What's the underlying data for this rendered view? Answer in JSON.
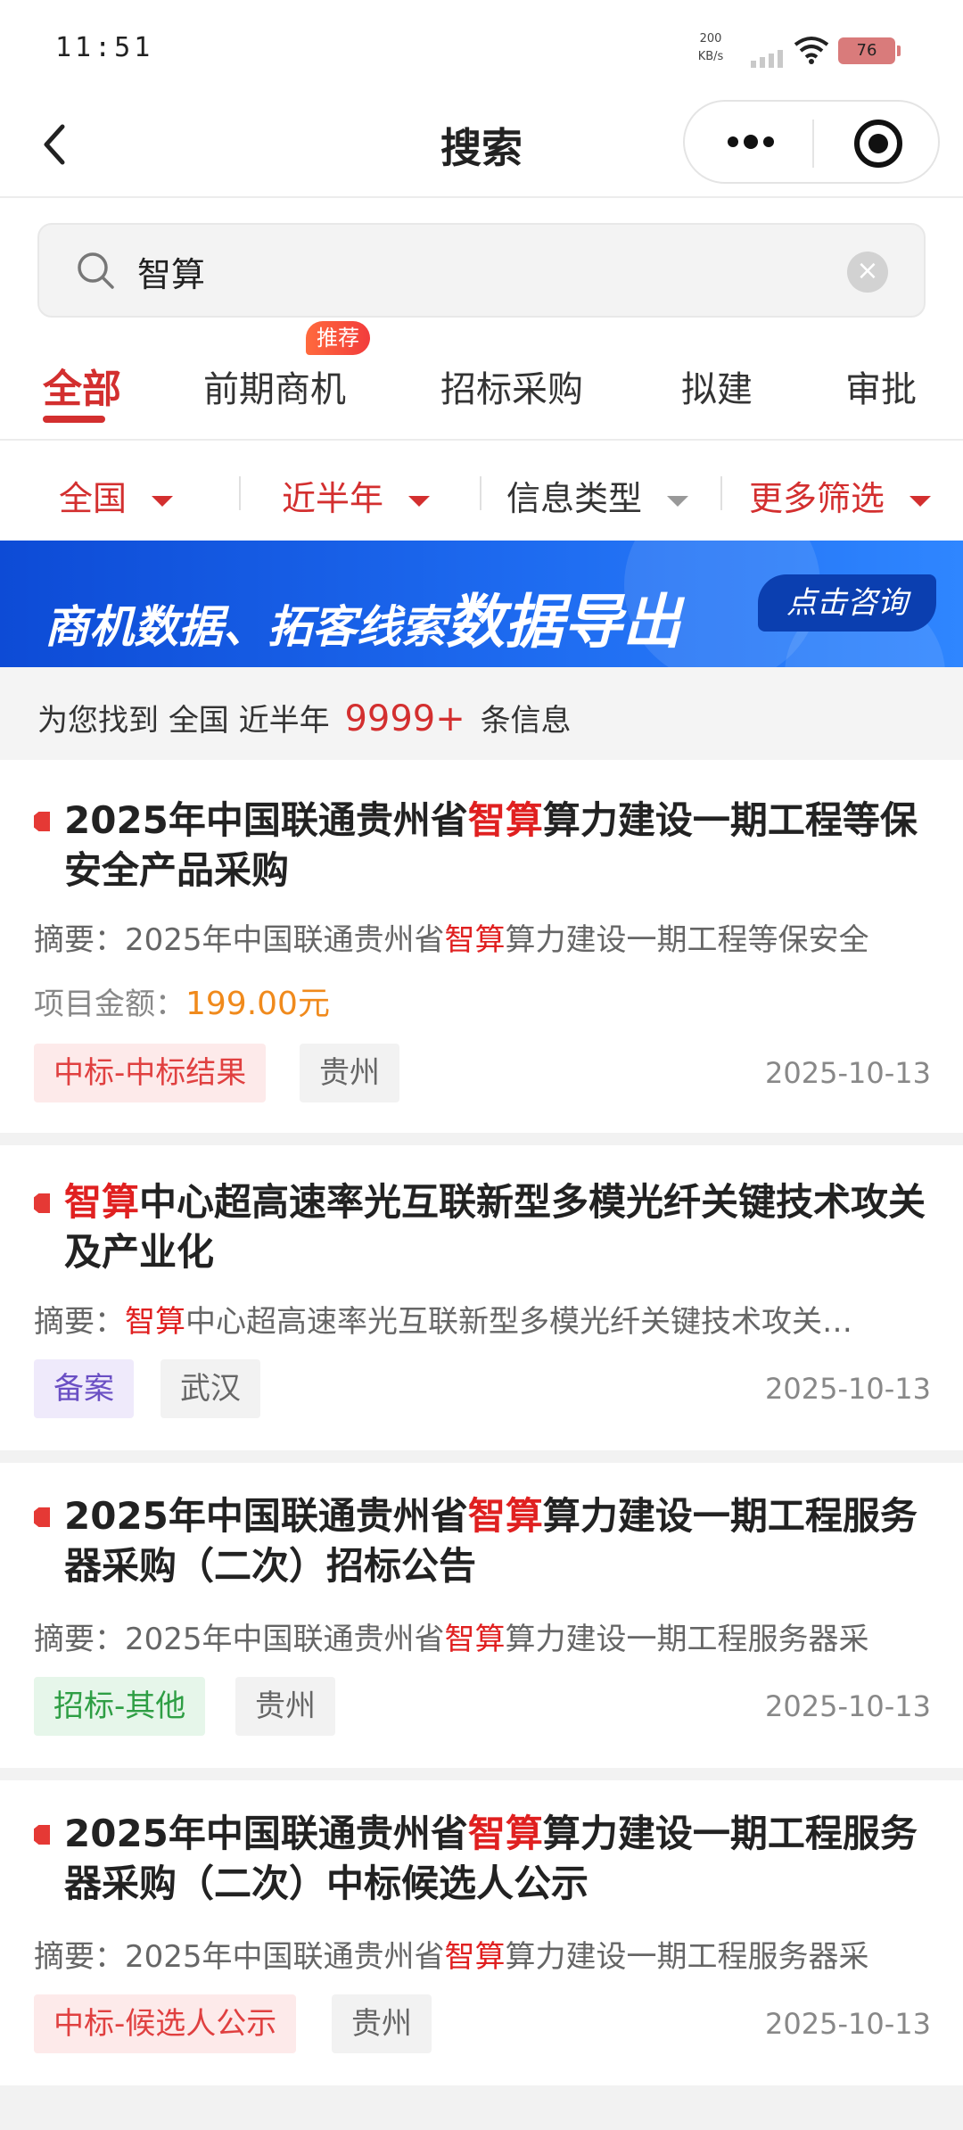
{
  "status_bar": {
    "time": "11:51",
    "net_speed_value": "200",
    "net_speed_unit": "KB/s",
    "battery": "76"
  },
  "nav": {
    "title": "搜索"
  },
  "search": {
    "value": "智算",
    "placeholder": ""
  },
  "tabs": [
    {
      "label": "全部",
      "active": true
    },
    {
      "label": "前期商机",
      "badge": "推荐"
    },
    {
      "label": "招标采购"
    },
    {
      "label": "拟建"
    },
    {
      "label": "审批"
    }
  ],
  "filters": [
    {
      "label": "全国",
      "color": "#d32f2f"
    },
    {
      "label": "近半年",
      "color": "#d32f2f"
    },
    {
      "label": "信息类型",
      "color": "#333333"
    },
    {
      "label": "更多筛选",
      "color": "#d32f2f"
    }
  ],
  "banner": {
    "text_small": "商机数据、拓客线索",
    "text_big": "数据导出",
    "button": "点击咨询"
  },
  "summary": {
    "prefix": "为您找到",
    "region": "全国",
    "period": "近半年",
    "count": "9999+",
    "suffix": "条信息"
  },
  "results": [
    {
      "title_pre": "2025年中国联通贵州省",
      "title_hl": "智算",
      "title_post": "算力建设一期工程等保安全产品采购",
      "summary_label": "摘要：",
      "summary_pre": "2025年中国联通贵州省",
      "summary_hl": "智算",
      "summary_post": "算力建设一期工程等保安全",
      "amount_label": "项目金额：",
      "amount_value": "199.00元",
      "tag_type": "中标-中标结果",
      "tag_region": "贵州",
      "date": "2025-10-13"
    },
    {
      "title_pre": "",
      "title_hl": "智算",
      "title_post": "中心超高速率光互联新型多模光纤关键技术攻关及产业化",
      "summary_label": "摘要：",
      "summary_pre": "",
      "summary_hl": "智算",
      "summary_post": "中心超高速率光互联新型多模光纤关键技术攻关…",
      "tag_type": "备案",
      "tag_region": "武汉",
      "date": "2025-10-13"
    },
    {
      "title_pre": "2025年中国联通贵州省",
      "title_hl": "智算",
      "title_post": "算力建设一期工程服务器采购（二次）招标公告",
      "summary_label": "摘要：",
      "summary_pre": "2025年中国联通贵州省",
      "summary_hl": "智算",
      "summary_post": "算力建设一期工程服务器采",
      "tag_type": "招标-其他",
      "tag_region": "贵州",
      "date": "2025-10-13"
    },
    {
      "title_pre": "2025年中国联通贵州省",
      "title_hl": "智算",
      "title_post": "算力建设一期工程服务器采购（二次）中标候选人公示",
      "summary_label": "摘要：",
      "summary_pre": "2025年中国联通贵州省",
      "summary_hl": "智算",
      "summary_post": "算力建设一期工程服务器采",
      "tag_type": "中标-候选人公示",
      "tag_region": "贵州",
      "date": "2025-10-13"
    }
  ],
  "icons": {
    "back": "chevron-left-icon",
    "more": "more-dots-icon",
    "close_app": "target-icon",
    "search": "search-icon",
    "clear": "clear-icon"
  },
  "colors": {
    "accent": "#d32f2f",
    "highlight": "#e02020",
    "amount": "#f08a1c",
    "banner": "#1e6bf0"
  }
}
